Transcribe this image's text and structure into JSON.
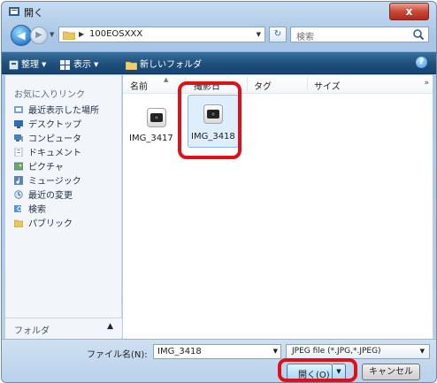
{
  "window": {
    "title": "開く",
    "close_label": "x"
  },
  "address": {
    "path": "100EOSXXX"
  },
  "search": {
    "placeholder": "検索"
  },
  "toolbar": {
    "organize_label": "整理",
    "view_label": "表示",
    "new_folder_label": "新しいフォルダ"
  },
  "nav": {
    "heading": "お気に入りリンク",
    "items": [
      {
        "label": "最近表示した場所",
        "icon": "recent-places-icon"
      },
      {
        "label": "デスクトップ",
        "icon": "desktop-icon"
      },
      {
        "label": "コンピュータ",
        "icon": "computer-icon"
      },
      {
        "label": "ドキュメント",
        "icon": "documents-icon"
      },
      {
        "label": "ピクチャ",
        "icon": "pictures-icon"
      },
      {
        "label": "ミュージック",
        "icon": "music-icon"
      },
      {
        "label": "最近の変更",
        "icon": "recently-changed-icon"
      },
      {
        "label": "検索",
        "icon": "searches-icon"
      },
      {
        "label": "パブリック",
        "icon": "public-folder-icon"
      }
    ],
    "folders_label": "フォルダ"
  },
  "columns": [
    "名前",
    "撮影日",
    "タグ",
    "サイズ"
  ],
  "files": [
    {
      "name": "IMG_3417",
      "selected": false
    },
    {
      "name": "IMG_3418",
      "selected": true
    }
  ],
  "bottom": {
    "filename_label": "ファイル名(N):",
    "filename_value": "IMG_3418",
    "filetype_value": "JPEG file (*.JPG,*.JPEG)",
    "open_label": "開く(O)",
    "cancel_label": "キャンセル"
  },
  "colors": {
    "highlight": "#e0101a",
    "toolbar": "#1f4f7c",
    "selection": "#dfeefc"
  }
}
